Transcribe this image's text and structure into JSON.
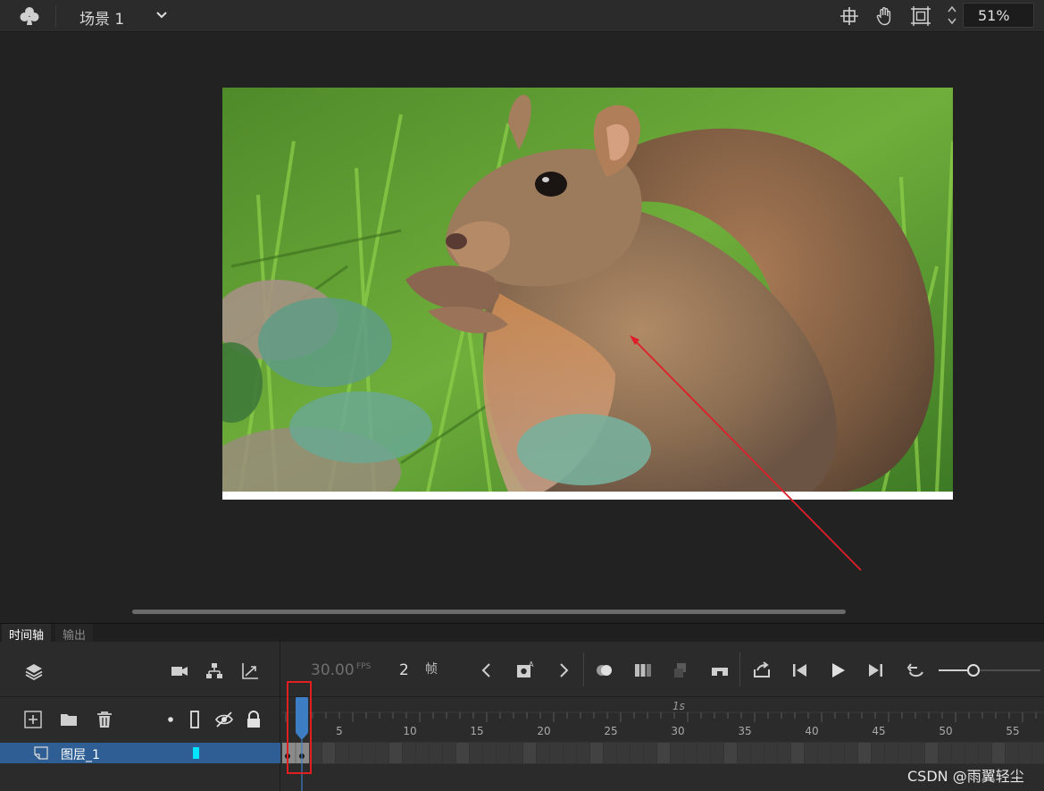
{
  "topbar": {
    "scene_label": "场景 1",
    "zoom": "51%",
    "icons": [
      "club-icon",
      "chevron-down-icon",
      "center-stage-icon",
      "hand-tool-icon",
      "clip-canvas-icon",
      "zoom-spinner-icon"
    ]
  },
  "stage": {
    "image_description_name": "squirrel-photo",
    "canvas_color": "#ffffff"
  },
  "timeline": {
    "tabs": [
      {
        "label": "时间轴",
        "active": true
      },
      {
        "label": "输出",
        "active": false
      }
    ],
    "fps": "30.00",
    "fps_unit": "FPS",
    "current_frame": "2",
    "frame_unit": "帧",
    "second_marker": "1s",
    "ruler_numbers": [
      "5",
      "10",
      "15",
      "20",
      "25",
      "30",
      "35",
      "40",
      "45",
      "50",
      "55"
    ],
    "layers": [
      {
        "name": "图层_1",
        "color": "#00e5ff",
        "selected": true
      }
    ]
  },
  "watermark": "CSDN @雨翼轻尘",
  "colors": {
    "accent": "#2e5e93",
    "playhead": "#3c7dc4",
    "highlight_box": "#e02020",
    "arrow": "#e01e2a"
  }
}
